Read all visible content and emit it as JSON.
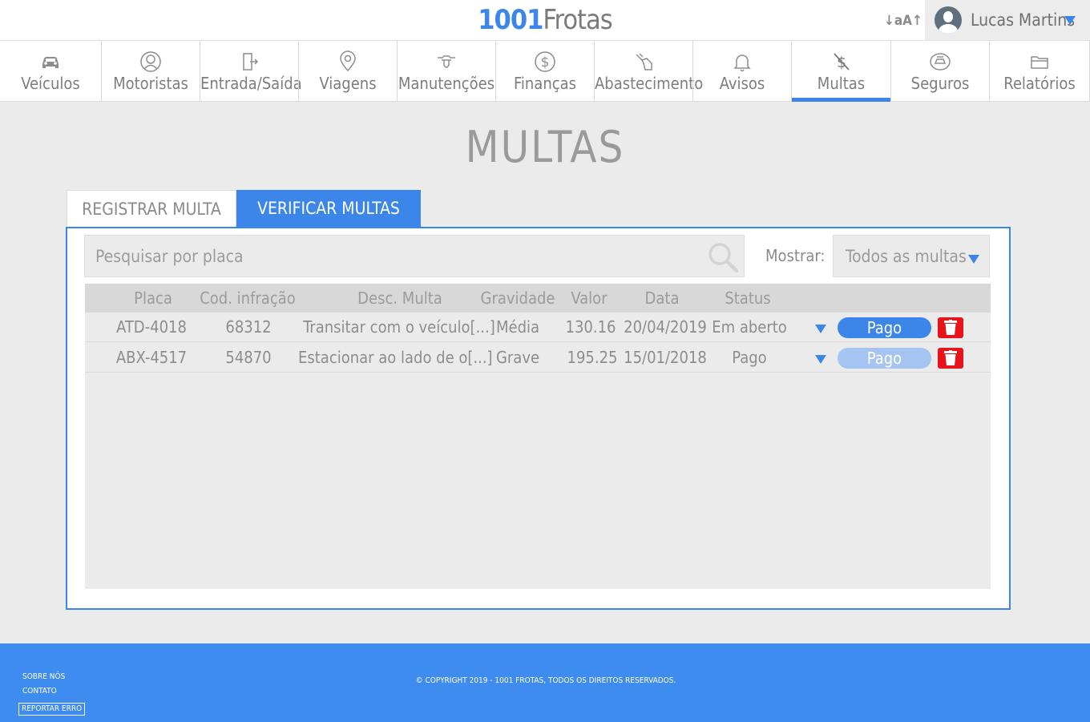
{
  "brand": {
    "number": "1001",
    "name": "Frotas"
  },
  "header": {
    "font_size_label": "↓aA↑",
    "user_name": "Lucas Martins"
  },
  "nav": {
    "items": [
      {
        "label": "Veículos"
      },
      {
        "label": "Motoristas"
      },
      {
        "label": "Entrada/Saída"
      },
      {
        "label": "Viagens"
      },
      {
        "label": "Manutenções"
      },
      {
        "label": "Finanças"
      },
      {
        "label": "Abastecimento"
      },
      {
        "label": "Avisos"
      },
      {
        "label": "Multas"
      },
      {
        "label": "Seguros"
      },
      {
        "label": "Relatórios"
      }
    ],
    "active": "Multas"
  },
  "page": {
    "title": "MULTAS"
  },
  "tabs": {
    "register": "REGISTRAR MULTA",
    "verify": "VERIFICAR MULTAS"
  },
  "filters": {
    "search_placeholder": "Pesquisar por placa",
    "show_label": "Mostrar:",
    "show_value": "Todos as multas"
  },
  "table": {
    "headers": {
      "plate": "Placa",
      "code": "Cod. infração",
      "desc": "Desc. Multa",
      "severity": "Gravidade",
      "value": "Valor",
      "date": "Data",
      "status": "Status"
    },
    "rows": [
      {
        "plate": "ATD-4018",
        "code": "68312",
        "desc": "Transitar com o veículo[...]",
        "severity": "Média",
        "value": "130.16",
        "date": "20/04/2019",
        "status": "Em aberto",
        "action": "Pago",
        "action_enabled": true
      },
      {
        "plate": "ABX-4517",
        "code": "54870",
        "desc": "Estacionar ao lado de o[...]",
        "severity": "Grave",
        "value": "195.25",
        "date": "15/01/2018",
        "status": "Pago",
        "action": "Pago",
        "action_enabled": false
      }
    ]
  },
  "footer": {
    "about": "SOBRE NÓS",
    "contact": "CONTATO",
    "report": "REPORTAR ERRO",
    "copyright": "© COPYRIGHT 2019 - 1001 FROTAS, TODOS OS DIREITOS RESERVADOS."
  },
  "colors": {
    "accent": "#3c86ea",
    "danger": "#e8141b",
    "footer": "#3f8cf0"
  }
}
